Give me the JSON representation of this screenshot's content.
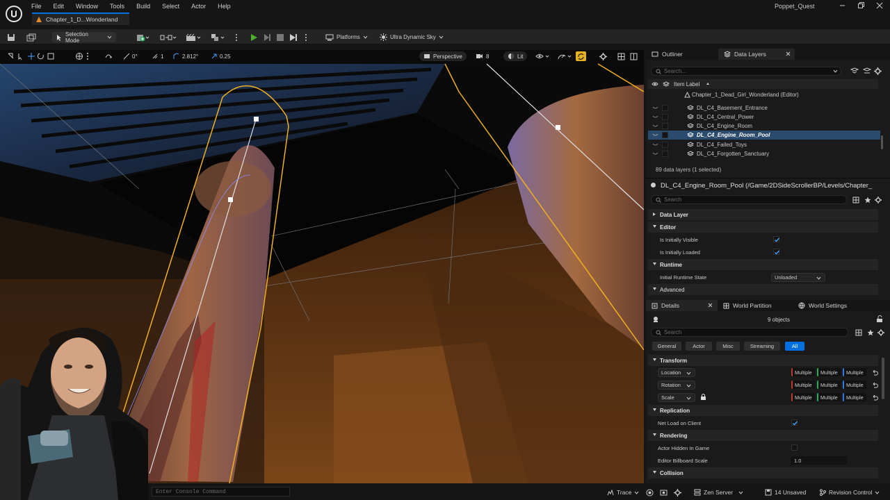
{
  "app": {
    "project_name": "Poppet_Quest",
    "document_tab": "Chapter_1_D...Wonderland"
  },
  "menu": [
    "File",
    "Edit",
    "Window",
    "Tools",
    "Build",
    "Select",
    "Actor",
    "Help"
  ],
  "toolbar": {
    "selection_mode": "Selection Mode",
    "platforms": "Platforms",
    "sky": "Ultra Dynamic Sky"
  },
  "viewport": {
    "grid_angle": "0°",
    "grid_size": "1",
    "rotation_snap": "2.812°",
    "scale_snap": "0.25",
    "view_mode": "Perspective",
    "camera_speed": "8",
    "lighting": "Lit"
  },
  "outliner": {
    "tab_outliner": "Outliner",
    "tab_data_layers": "Data Layers",
    "search_placeholder": "Search...",
    "column_label": "Item Label",
    "root": "Chapter_1_Dead_Girl_Wonderland (Editor)",
    "items": [
      "DL_C4_Basement_Entrance",
      "DL_C4_Central_Power",
      "DL_C4_Engine_Room",
      "DL_C4_Engine_Room_Pool",
      "DL_C4_Failed_Toys",
      "DL_C4_Forgotten_Sanctuary"
    ],
    "selected_item": "DL_C4_Engine_Room_Pool",
    "count": "89 data layers (1 selected)"
  },
  "layer_details": {
    "header": "DL_C4_Engine_Room_Pool (/Game/2DSideScrollerBP/Levels/Chapter_",
    "search_placeholder": "Search",
    "sections": {
      "data_layer": "Data Layer",
      "editor": "Editor",
      "runtime": "Runtime",
      "advanced": "Advanced"
    },
    "initially_visible_label": "Is Initially Visible",
    "initially_loaded_label": "Is Initially Loaded",
    "runtime_state_label": "Initial Runtime State",
    "runtime_state_value": "Unloaded"
  },
  "details": {
    "tab_details": "Details",
    "tab_world_partition": "World Partition",
    "tab_world_settings": "World Settings",
    "objects": "9 objects",
    "search_placeholder": "Search",
    "filters": [
      "General",
      "Actor",
      "Misc",
      "Streaming",
      "All"
    ],
    "active_filter": "All",
    "transform_section": "Transform",
    "location": "Location",
    "rotation": "Rotation",
    "scale": "Scale",
    "multiple": "Multiple",
    "replication_section": "Replication",
    "net_load_label": "Net Load on Client",
    "rendering_section": "Rendering",
    "hidden_label": "Actor Hidden In Game",
    "billboard_label": "Editor Billboard Scale",
    "billboard_value": "1.0",
    "collision_section": "Collision"
  },
  "status": {
    "console_placeholder": "Enter Console Command",
    "trace": "Trace",
    "zen": "Zen Server",
    "unsaved": "14 Unsaved",
    "revision": "Revision Control"
  }
}
